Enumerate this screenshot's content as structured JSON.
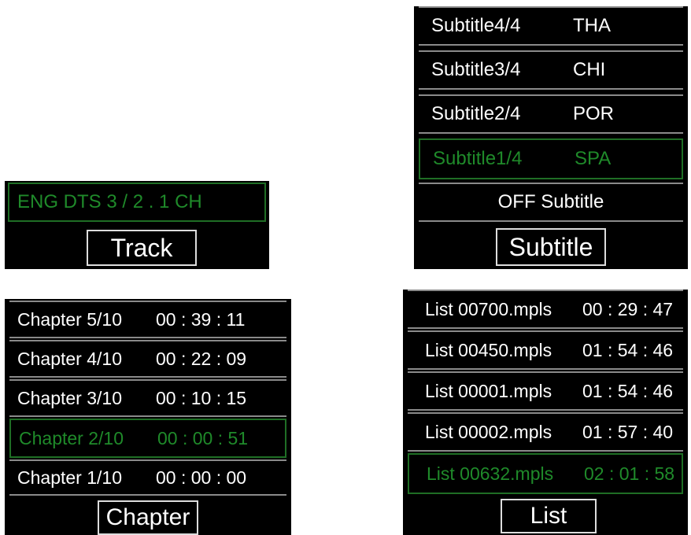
{
  "track": {
    "selected": "ENG  DTS  3 / 2 . 1 CH",
    "title": "Track"
  },
  "subtitle": {
    "items": [
      {
        "name": "Subtitle4/4",
        "lang": "THA"
      },
      {
        "name": "Subtitle3/4",
        "lang": "CHI"
      },
      {
        "name": "Subtitle2/4",
        "lang": "POR"
      },
      {
        "name": "Subtitle1/4",
        "lang": "SPA"
      }
    ],
    "off": "OFF Subtitle",
    "title": "Subtitle"
  },
  "chapter": {
    "items": [
      {
        "name": "Chapter 5/10",
        "time": "00 : 39 : 11"
      },
      {
        "name": "Chapter 4/10",
        "time": "00 : 22 : 09"
      },
      {
        "name": "Chapter 3/10",
        "time": "00 : 10 : 15"
      },
      {
        "name": "Chapter 2/10",
        "time": "00 : 00 : 51"
      },
      {
        "name": "Chapter 1/10",
        "time": "00 : 00 : 00"
      }
    ],
    "title": "Chapter"
  },
  "list": {
    "items": [
      {
        "name": "List  00700.mpls",
        "time": "00 : 29 : 47"
      },
      {
        "name": "List  00450.mpls",
        "time": "01 : 54 : 46"
      },
      {
        "name": "List  00001.mpls",
        "time": "01 : 54 : 46"
      },
      {
        "name": "List  00002.mpls",
        "time": "01 : 57 : 40"
      },
      {
        "name": "List  00632.mpls",
        "time": "02 : 01 : 58"
      }
    ],
    "title": "List"
  },
  "colors": {
    "active_text": "#1f8a2a",
    "background": "#000000"
  }
}
